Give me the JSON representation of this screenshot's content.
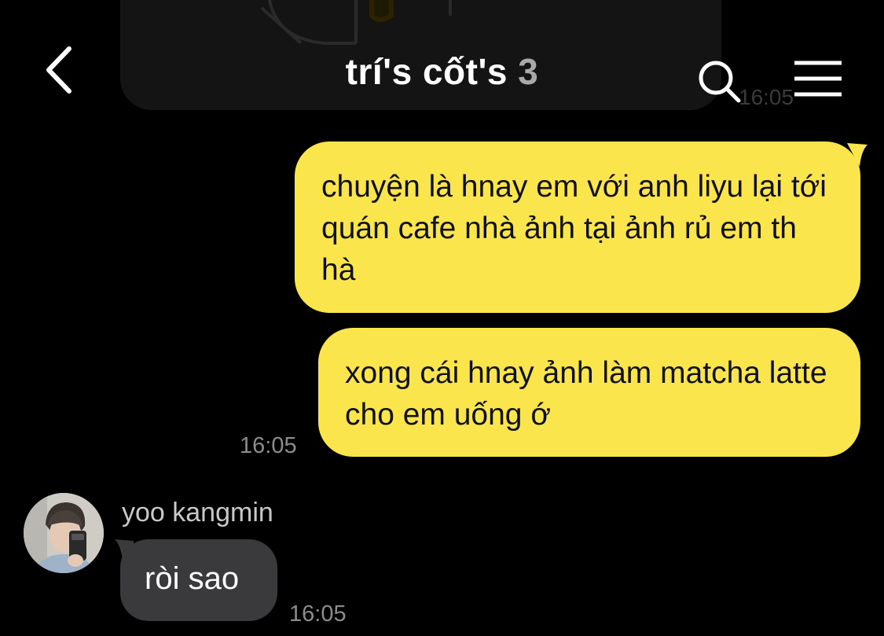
{
  "header": {
    "title": "trí's cốt's",
    "member_count": "3",
    "back_icon": "chevron-left-icon",
    "search_icon": "search-icon",
    "menu_icon": "hamburger-menu-icon"
  },
  "previous_message": {
    "time": "16:05"
  },
  "messages": [
    {
      "from": "me",
      "text": "chuyện là hnay em với anh liyu lại tới quán cafe nhà ảnh tại ảnh rủ em th hà"
    },
    {
      "from": "me",
      "text": "xong cái hnay ảnh làm matcha latte cho em uống ớ",
      "time": "16:05"
    },
    {
      "from": "other",
      "sender": "yoo kangmin",
      "text": "ròi sao",
      "time": "16:05"
    }
  ],
  "colors": {
    "background": "#000000",
    "my_bubble": "#fae64c",
    "other_bubble": "#3a3a3c",
    "timestamp": "#8c8c8c"
  }
}
